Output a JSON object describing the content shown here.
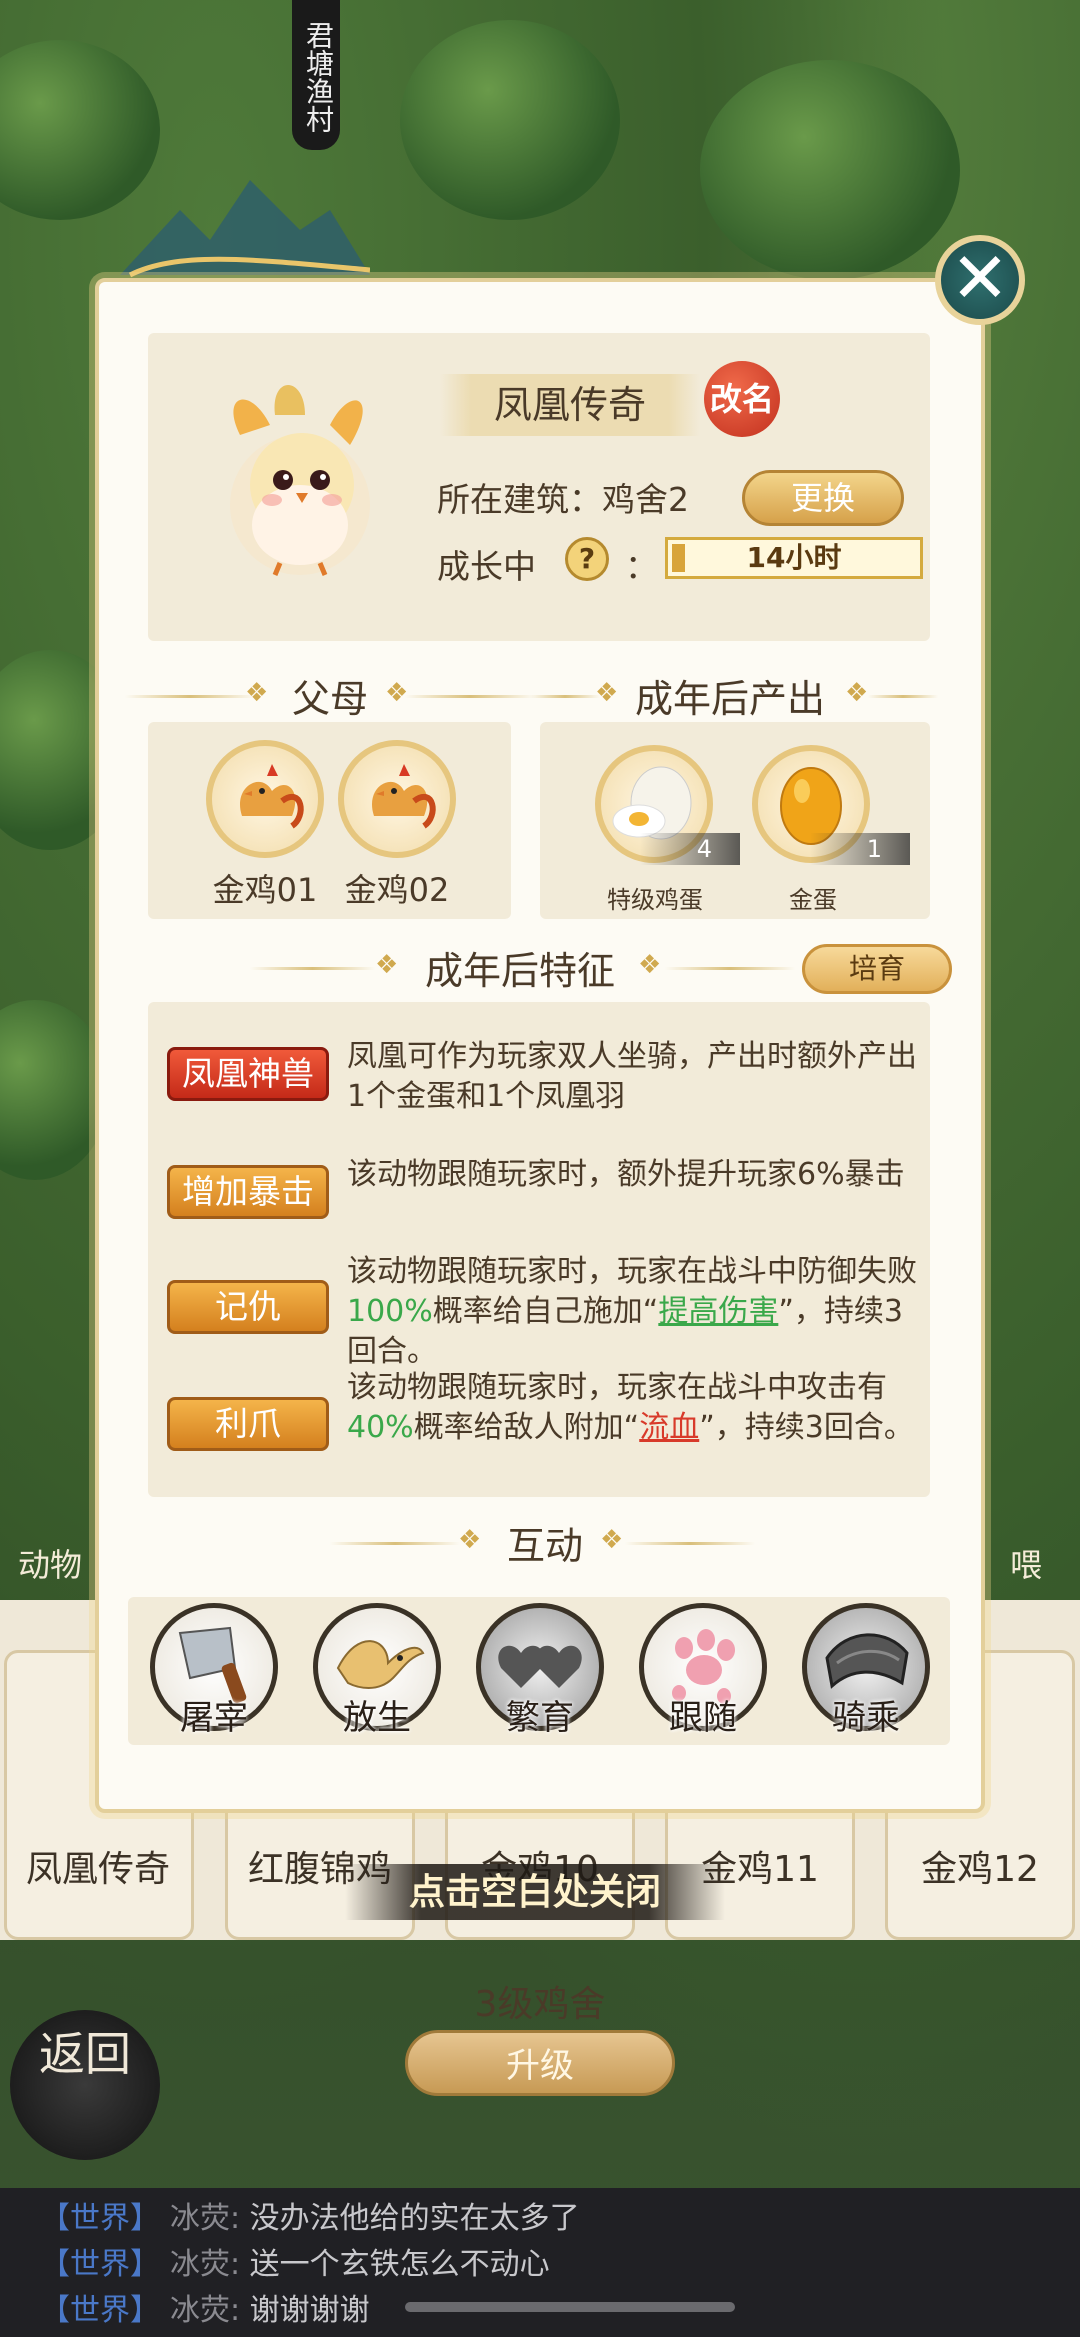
{
  "background": {
    "village_banner": "君塘渔村"
  },
  "dialog": {
    "pet": {
      "name": "凤凰传奇",
      "rename_label": "改名",
      "building_label": "所在建筑：鸡舍2",
      "change_label": "更换",
      "growth_label": "成长中",
      "help_symbol": "?",
      "growth_colon": "：",
      "growth_time": "14小时",
      "growth_progress": 0.05
    },
    "parents": {
      "title": "父母",
      "items": [
        {
          "name": "金鸡01"
        },
        {
          "name": "金鸡02"
        }
      ]
    },
    "output": {
      "title": "成年后产出",
      "items": [
        {
          "name": "特级鸡蛋",
          "count": "4"
        },
        {
          "name": "金蛋",
          "count": "1"
        }
      ]
    },
    "traits": {
      "title": "成年后特征",
      "breed_label": "培育",
      "items": [
        {
          "tag": "凤凰神兽",
          "color": "#d83a24",
          "desc": "凤凰可作为玩家双人坐骑，产出时额外产出1个金蛋和1个凤凰羽"
        },
        {
          "tag": "增加暴击",
          "color": "#e49a2e",
          "desc": "该动物跟随玩家时，额外提升玩家6%暴击"
        },
        {
          "tag": "记仇",
          "color": "#e49a2e",
          "desc_a": "该动物跟随玩家时，玩家在战斗中防御失败",
          "desc_pct": "100%",
          "desc_b": "概率给自己施加“",
          "desc_link": "提高伤害",
          "desc_c": "”，持续3回合。"
        },
        {
          "tag": "利爪",
          "color": "#e49a2e",
          "desc_a": "该动物跟随玩家时，玩家在战斗中攻击有",
          "desc_pct": "40%",
          "desc_b": "概率给敌人附加“",
          "desc_link": "流血",
          "desc_c": "”，持续3回合。"
        }
      ]
    },
    "interact": {
      "title": "互动",
      "actions": [
        {
          "label": "屠宰",
          "icon": "cleaver-icon"
        },
        {
          "label": "放生",
          "icon": "bird-icon"
        },
        {
          "label": "繁育",
          "icon": "hearts-icon"
        },
        {
          "label": "跟随",
          "icon": "pawprint-icon"
        },
        {
          "label": "骑乘",
          "icon": "saddle-icon"
        }
      ]
    }
  },
  "close_hint": "点击空白处关闭",
  "buildings": {
    "cards": [
      "凤凰传奇",
      "红腹锦鸡",
      "金鸡10",
      "金鸡11",
      "金鸡12"
    ],
    "shed_label": "3级鸡舍",
    "upgrade_label": "升级",
    "side_left": "动物",
    "side_right": "喂"
  },
  "back_label": "返回",
  "chat": [
    {
      "channel": "【世界】",
      "name": "冰荧:",
      "msg": "没办法他给的实在太多了"
    },
    {
      "channel": "【世界】",
      "name": "冰荧:",
      "msg": "送一个玄铁怎么不动心"
    },
    {
      "channel": "【世界】",
      "name": "冰荧:",
      "msg": "谢谢谢谢"
    }
  ]
}
